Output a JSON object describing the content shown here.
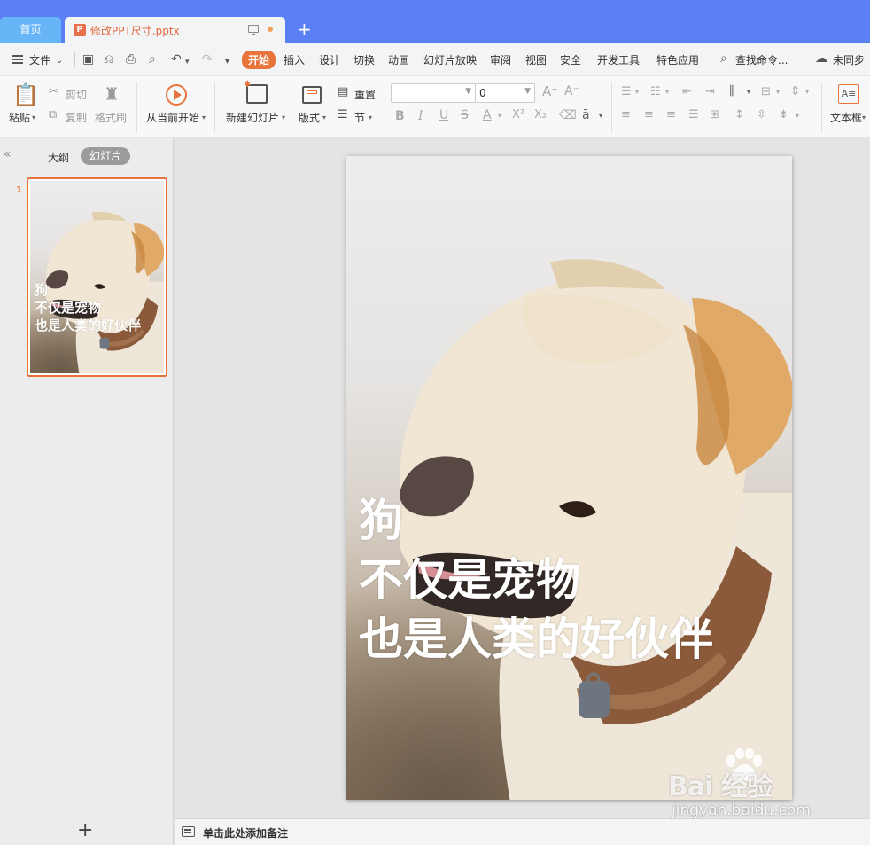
{
  "tabs": {
    "home": "首页",
    "document": "修改PPT尺寸.pptx",
    "add": "+"
  },
  "menu": {
    "file": "文件",
    "items": [
      "开始",
      "插入",
      "设计",
      "切换",
      "动画",
      "幻灯片放映",
      "审阅",
      "视图",
      "安全",
      "开发工具",
      "特色应用"
    ],
    "active": "开始",
    "search": "查找命令...",
    "sync": "未同步"
  },
  "ribbon": {
    "paste": "粘贴",
    "cut": "剪切",
    "copy": "复制",
    "format_painter": "格式刷",
    "play_from_current": "从当前开始",
    "new_slide": "新建幻灯片",
    "layout": "版式",
    "reset": "重置",
    "section": "节",
    "font_size": "0",
    "text_box": "文本框"
  },
  "left_panel": {
    "tab_outline": "大纲",
    "tab_slides": "幻灯片",
    "slide_number": "1",
    "add_slide": "+"
  },
  "slide": {
    "lines": [
      "狗",
      "不仅是宠物",
      "也是人类的好伙伴"
    ]
  },
  "notes": {
    "placeholder": "单击此处添加备注"
  },
  "watermark": {
    "brand": "Bai 经验",
    "url": "jingyan.baidu.com"
  },
  "colors": {
    "tabbar": "#5b80f5",
    "accent": "#e8743b",
    "selection": "#e8743b"
  }
}
